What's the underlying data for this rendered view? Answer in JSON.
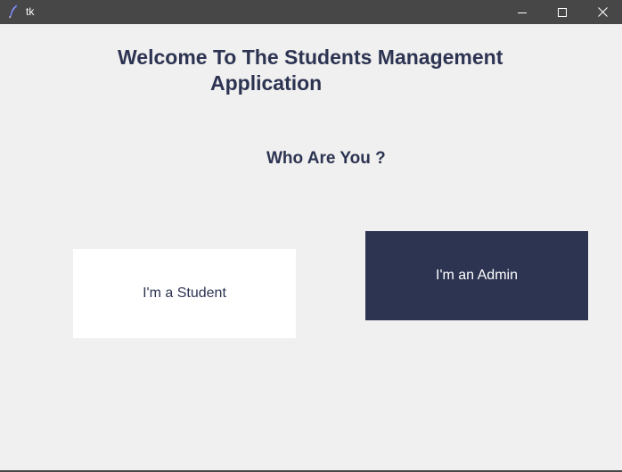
{
  "window": {
    "title": "tk",
    "icon": "tk-feather-icon",
    "controls": {
      "minimize_icon": "minimize-icon",
      "maximize_icon": "maximize-icon",
      "close_icon": "close-icon"
    }
  },
  "main": {
    "heading_line1": "Welcome To The Students Management",
    "heading_line2": "Application",
    "prompt": "Who Are You ?",
    "student_button_label": "I'm a Student",
    "admin_button_label": "I'm an Admin"
  },
  "colors": {
    "titlebar": "#474747",
    "background": "#f0f0f0",
    "accent_navy": "#2d3452",
    "student_button_bg": "#ffffff",
    "admin_button_bg": "#2d3452"
  }
}
